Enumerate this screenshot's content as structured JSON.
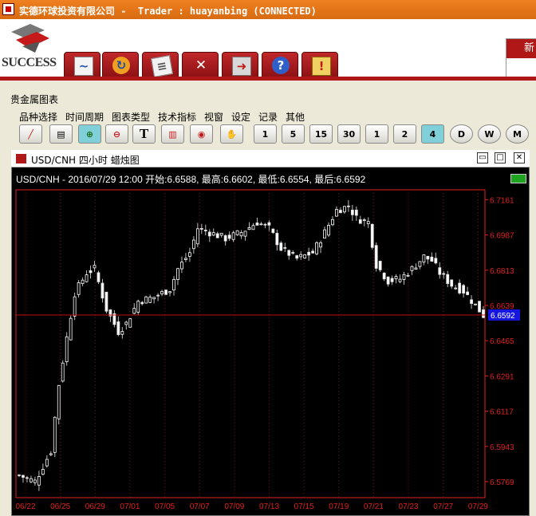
{
  "window": {
    "title": "实德环球投资有限公司 -  Trader : huayanbing (CONNECTED)"
  },
  "logo": {
    "text": "SUCCESS"
  },
  "new_tab": {
    "label": "新"
  },
  "main_toolbar": [
    "chart-icon",
    "refresh-icon",
    "order-icon",
    "tools-icon",
    "exit-icon",
    "help-icon",
    "alert-icon"
  ],
  "panel": {
    "tab_label": "贵金属图表"
  },
  "chart_menu": [
    "品种选择",
    "时间周期",
    "图表类型",
    "技术指标",
    "视窗",
    "设定",
    "记录",
    "其他"
  ],
  "chart_toolbar": {
    "tools": [
      "line-draw-icon",
      "print-icon",
      "zoom-in-icon",
      "zoom-out-icon",
      "text-icon",
      "delete-icon",
      "record-icon",
      "hand-icon"
    ],
    "periods": [
      "1",
      "5",
      "15",
      "30",
      "1",
      "2",
      "4",
      "D",
      "W",
      "M"
    ],
    "active_period_index": 6
  },
  "chart_window": {
    "title": "USD/CNH 四小时 蜡烛图",
    "info_line": "USD/CNH - 2016/07/29 12:00 开始:6.6588, 最高:6.6602, 最低:6.6554, 最后:6.6592",
    "current_price_label": "6.6592"
  },
  "chart_data": {
    "type": "candlestick",
    "symbol": "USD/CNH",
    "period": "四小时",
    "y_ticks": [
      "6.7161",
      "6.6987",
      "6.6813",
      "6.6639",
      "6.6465",
      "6.6291",
      "6.6117",
      "6.5943",
      "6.5769"
    ],
    "y_range": [
      6.569,
      6.721
    ],
    "x_ticks": [
      "06/22",
      "06/25",
      "06/29",
      "07/01",
      "07/05",
      "07/07",
      "07/09",
      "07/13",
      "07/15",
      "07/19",
      "07/21",
      "07/23",
      "07/27",
      "07/29"
    ],
    "last_price": 6.6592,
    "last_bar": {
      "time": "2016/07/29 12:00",
      "open": 6.6588,
      "high": 6.6602,
      "low": 6.6554,
      "close": 6.6592
    },
    "close_path": [
      [
        0,
        6.58
      ],
      [
        4,
        6.577
      ],
      [
        8,
        6.592
      ],
      [
        10,
        6.625
      ],
      [
        12,
        6.648
      ],
      [
        14,
        6.67
      ],
      [
        17,
        6.68
      ],
      [
        19,
        6.682
      ],
      [
        22,
        6.662
      ],
      [
        25,
        6.651
      ],
      [
        27,
        6.655
      ],
      [
        30,
        6.666
      ],
      [
        34,
        6.668
      ],
      [
        38,
        6.672
      ],
      [
        40,
        6.682
      ],
      [
        43,
        6.69
      ],
      [
        45,
        6.702
      ],
      [
        48,
        6.7
      ],
      [
        52,
        6.697
      ],
      [
        56,
        6.7
      ],
      [
        60,
        6.705
      ],
      [
        63,
        6.702
      ],
      [
        66,
        6.692
      ],
      [
        70,
        6.687
      ],
      [
        74,
        6.69
      ],
      [
        77,
        6.7
      ],
      [
        80,
        6.711
      ],
      [
        83,
        6.713
      ],
      [
        85,
        6.707
      ],
      [
        88,
        6.705
      ],
      [
        90,
        6.684
      ],
      [
        93,
        6.676
      ],
      [
        96,
        6.677
      ],
      [
        99,
        6.682
      ],
      [
        102,
        6.688
      ],
      [
        104,
        6.686
      ],
      [
        106,
        6.68
      ],
      [
        109,
        6.674
      ],
      [
        112,
        6.671
      ],
      [
        115,
        6.664
      ],
      [
        117,
        6.659
      ]
    ],
    "colors": {
      "up": "#ffffff",
      "down": "#e0e0e0",
      "grid": "#7a1010",
      "axis": "#e02020",
      "price_line": "#c01010",
      "price_label_bg": "#1616e0"
    }
  }
}
